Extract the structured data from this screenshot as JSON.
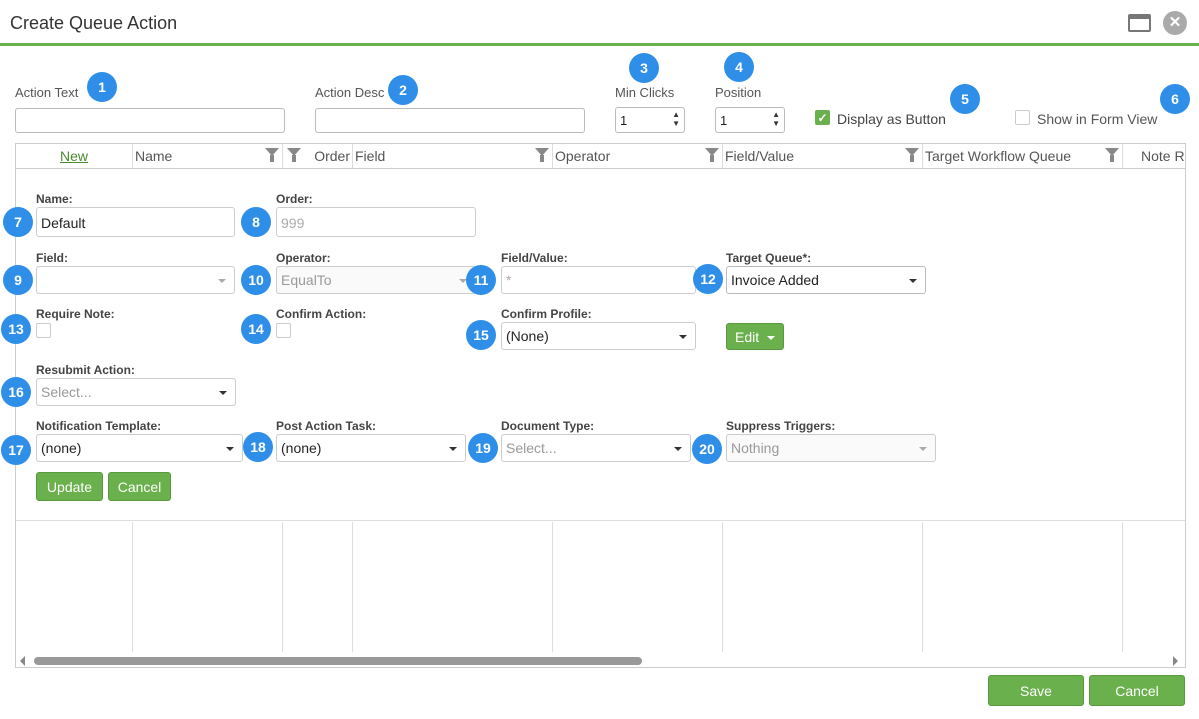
{
  "window": {
    "title": "Create Queue Action",
    "close_glyph": "✕"
  },
  "top_fields": {
    "action_text_label": "Action Text",
    "action_desc_label": "Action Desc",
    "min_clicks_label": "Min Clicks",
    "min_clicks_value": "1",
    "position_label": "Position",
    "position_value": "1",
    "display_as_button_label": "Display as Button",
    "display_as_button_checked": true,
    "show_in_form_view_label": "Show in Form View",
    "show_in_form_view_checked": false
  },
  "grid": {
    "new_link": "New",
    "columns": [
      "Name",
      "Order",
      "Field",
      "Operator",
      "Field/Value",
      "Target Workflow Queue",
      "Note R"
    ]
  },
  "edit_form": {
    "name_label": "Name:",
    "name_value": "Default",
    "order_label": "Order:",
    "order_placeholder": "999",
    "field_label": "Field:",
    "operator_label": "Operator:",
    "operator_value": "EqualTo",
    "field_value_label": "Field/Value:",
    "field_value_placeholder": "*",
    "target_queue_label": "Target Queue*:",
    "target_queue_value": "Invoice Added",
    "require_note_label": "Require Note:",
    "confirm_action_label": "Confirm Action:",
    "confirm_profile_label": "Confirm Profile:",
    "confirm_profile_value": "(None)",
    "edit_button": "Edit",
    "resubmit_action_label": "Resubmit Action:",
    "resubmit_action_value": "Select...",
    "notification_template_label": "Notification Template:",
    "notification_template_value": "(none)",
    "post_action_task_label": "Post Action Task:",
    "post_action_task_value": "(none)",
    "document_type_label": "Document Type:",
    "document_type_value": "Select...",
    "suppress_triggers_label": "Suppress Triggers:",
    "suppress_triggers_value": "Nothing",
    "update_button": "Update",
    "cancel_button": "Cancel"
  },
  "badges": [
    "1",
    "2",
    "3",
    "4",
    "5",
    "6",
    "7",
    "8",
    "9",
    "10",
    "11",
    "12",
    "13",
    "14",
    "15",
    "16",
    "17",
    "18",
    "19",
    "20"
  ],
  "footer": {
    "save_button": "Save",
    "cancel_button": "Cancel"
  },
  "colors": {
    "accent_green": "#6ab04c",
    "badge_blue": "#2f8fe8"
  },
  "scrollbar": {
    "position_fraction": 0.0
  }
}
